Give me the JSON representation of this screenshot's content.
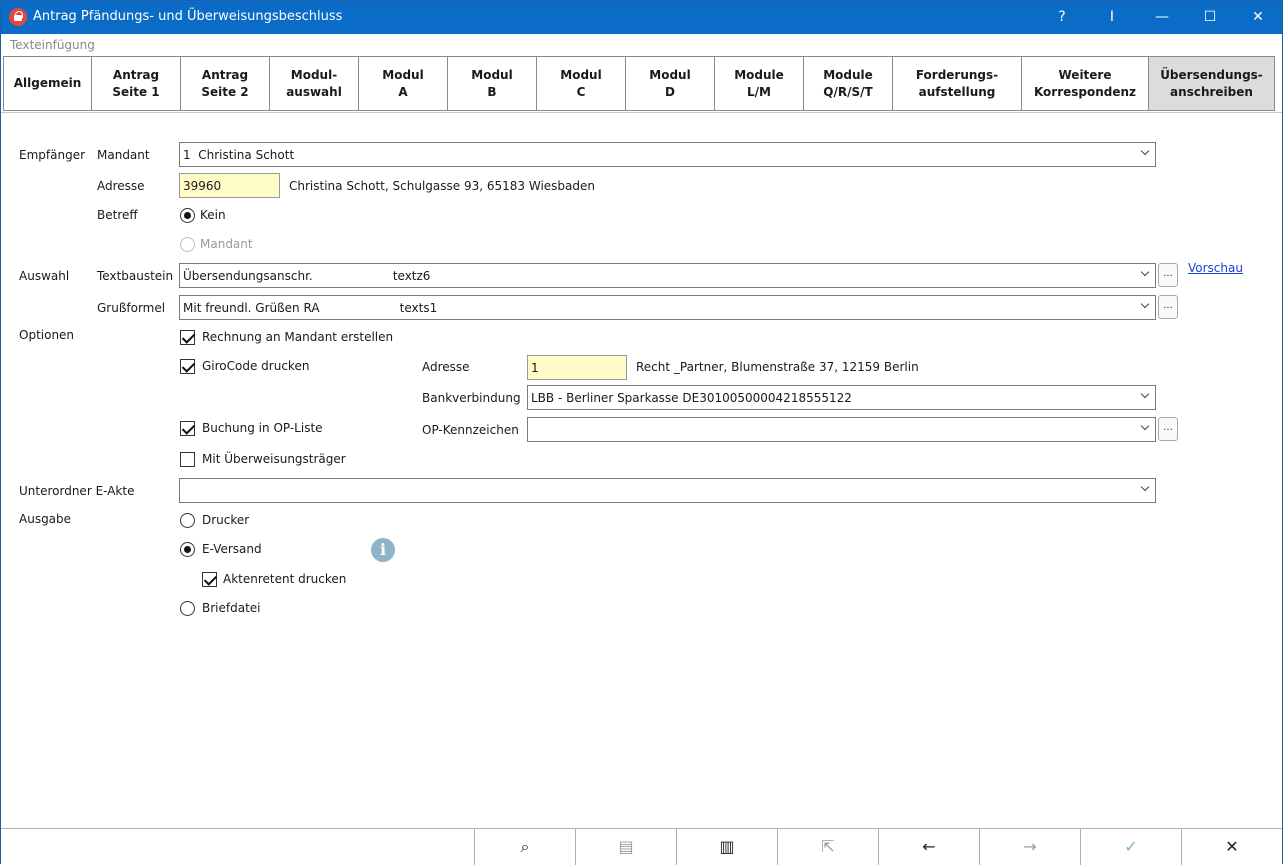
{
  "window": {
    "title": "Antrag Pfändungs- und Überweisungsbeschluss",
    "controls": {
      "help": "?",
      "pin": "I",
      "minimize": "—",
      "maximize": "☐",
      "close": "✕"
    }
  },
  "menu": {
    "label": "Texteinfügung"
  },
  "tabs": [
    {
      "label": "Allgemein"
    },
    {
      "label": "Antrag\nSeite 1"
    },
    {
      "label": "Antrag\nSeite 2"
    },
    {
      "label": "Modul-\nauswahl"
    },
    {
      "label": "Modul\nA"
    },
    {
      "label": "Modul\nB"
    },
    {
      "label": "Modul\nC"
    },
    {
      "label": "Modul\nD"
    },
    {
      "label": "Module\nL/M"
    },
    {
      "label": "Module\nQ/R/S/T"
    },
    {
      "label": "Forderungs-\naufstellung"
    },
    {
      "label": "Weitere\nKorrespondenz"
    },
    {
      "label": "Übersendungs-\nanschreiben"
    }
  ],
  "empfaenger": {
    "section_label": "Empfänger",
    "mandant_label": "Mandant",
    "mandant_value": "1  Christina Schott",
    "adresse_label": "Adresse",
    "adresse_value": "39960",
    "adresse_text": "Christina Schott, Schulgasse 93, 65183 Wiesbaden",
    "betreff_label": "Betreff",
    "betreff_options": [
      "Kein",
      "Mandant"
    ]
  },
  "auswahl": {
    "section_label": "Auswahl",
    "textbaustein_label": "Textbaustein",
    "textbaustein_value": "Übersendungsanschr.                     textz6",
    "grussformel_label": "Grußformel",
    "grussformel_value": "Mit freundl. Grüßen RA                     texts1",
    "vorschau_link": "Vorschau",
    "dots": "..."
  },
  "optionen": {
    "section_label": "Optionen",
    "rechnung": "Rechnung an Mandant erstellen",
    "girocode": "GiroCode drucken",
    "buchung": "Buchung in OP-Liste",
    "ueberweisung": "Mit Überweisungsträger",
    "adresse_label": "Adresse",
    "adresse_value": "1",
    "adresse_text": "Recht _Partner, Blumenstraße 37, 12159 Berlin",
    "bank_label": "Bankverbindung",
    "bank_value": "LBB - Berliner Sparkasse DE30100500004218555122",
    "op_label": "OP-Kennzeichen",
    "op_value": ""
  },
  "unterordner": {
    "label": "Unterordner E-Akte",
    "value": ""
  },
  "ausgabe": {
    "section_label": "Ausgabe",
    "drucker": "Drucker",
    "eversand": "E-Versand",
    "aktenretent": "Aktenretent drucken",
    "briefdatei": "Briefdatei",
    "info_glyph": "i"
  },
  "footer": {
    "search": "⌕",
    "doc1": "▤",
    "doc2": "▥",
    "doc3": "⇱",
    "back": "←",
    "forward": "→",
    "ok": "✓",
    "cancel": "✕"
  }
}
